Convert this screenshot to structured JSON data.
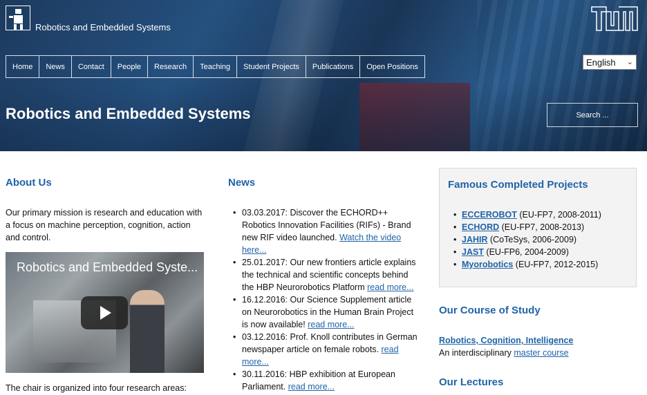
{
  "header": {
    "site_name": "Robotics and Embedded Systems",
    "nav": [
      "Home",
      "News",
      "Contact",
      "People",
      "Research",
      "Teaching",
      "Student Projects",
      "Publications",
      "Open Positions"
    ],
    "language": "English",
    "hero_title": "Robotics and Embedded Systems",
    "search_placeholder": "Search ..."
  },
  "about": {
    "title": "About Us",
    "text": "Our primary mission is research and education with a focus on machine perception, cognition, action and control.",
    "video_title": "Robotics and Embedded Syste...",
    "areas_text": "The chair is organized into four research areas:"
  },
  "news": {
    "title": "News",
    "items": [
      {
        "text": "03.03.2017: Discover the ECHORD++ Robotics Innovation Facilities (RIFs) - Brand new RIF video launched. ",
        "link": "Watch the video here..."
      },
      {
        "text": "25.01.2017: Our new frontiers article explains the technical and scientific concepts behind the HBP Neurorobotics Platform ",
        "link": "read more..."
      },
      {
        "text": "16.12.2016: Our Science Supplement article on Neurorobotics in the Human Brain Project is now available! ",
        "link": "read more..."
      },
      {
        "text": "03.12.2016: Prof. Knoll contributes in German newspaper article on female robots. ",
        "link": "read more..."
      },
      {
        "text": "30.11.2016: HBP exhibition at European Parliament. ",
        "link": "read more..."
      }
    ]
  },
  "projects": {
    "title": "Famous Completed Projects",
    "items": [
      {
        "name": "ECCEROBOT",
        "detail": " (EU-FP7, 2008-2011)"
      },
      {
        "name": "ECHORD",
        "detail": " (EU-FP7, 2008-2013)"
      },
      {
        "name": "JAHIR",
        "detail": " (CoTeSys, 2006-2009)"
      },
      {
        "name": "JAST",
        "detail": " (EU-FP6, 2004-2009)"
      },
      {
        "name": "Myorobotics",
        "detail": " (EU-FP7, 2012-2015)"
      }
    ]
  },
  "course": {
    "title": "Our Course of Study",
    "link": "Robotics, Cognition, Intelligence",
    "desc_prefix": "An interdisciplinary ",
    "desc_link": "master course"
  },
  "lectures": {
    "title": "Our Lectures"
  },
  "colors": {
    "accent": "#1f63a8",
    "hero": "#25507f",
    "box_bg": "#f3f3f3"
  }
}
